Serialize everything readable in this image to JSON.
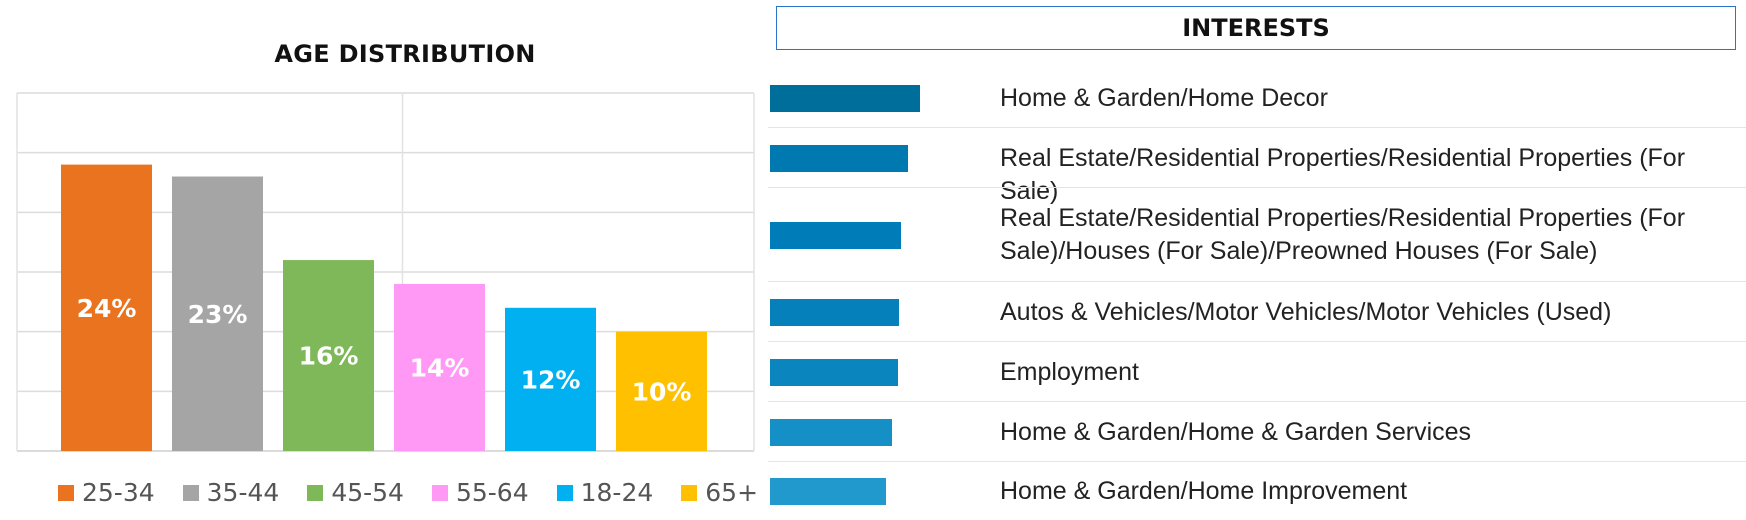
{
  "chart_data": [
    {
      "type": "bar",
      "title": "AGE DISTRIBUTION",
      "categories": [
        "25-34",
        "35-44",
        "45-54",
        "55-64",
        "18-24",
        "65+"
      ],
      "values": [
        24,
        23,
        16,
        14,
        12,
        10
      ],
      "data_labels": [
        "24%",
        "23%",
        "16%",
        "14%",
        "12%",
        "10%"
      ],
      "colors": [
        "#ea7320",
        "#a5a5a5",
        "#7fb858",
        "#ff99f5",
        "#00b0f0",
        "#ffc000"
      ],
      "legend": [
        "25-34",
        "35-44",
        "45-54",
        "55-64",
        "18-24",
        "65+"
      ],
      "legend_position": "bottom",
      "ylim": [
        0,
        30
      ],
      "grid": true,
      "xlabel": "",
      "ylabel": ""
    },
    {
      "type": "bar",
      "orientation": "horizontal",
      "title": "INTERESTS",
      "categories": [
        "Home & Garden/Home Decor",
        "Real Estate/Residential Properties/Residential Properties (For Sale)",
        "Real Estate/Residential Properties/Residential Properties (For Sale)/Houses (For Sale)/Preowned Houses (For Sale)",
        "Autos & Vehicles/Motor Vehicles/Motor Vehicles (Used)",
        "Employment",
        "Home & Garden/Home & Garden Services",
        "Home & Garden/Home Improvement"
      ],
      "values": [
        1.0,
        0.92,
        0.87,
        0.86,
        0.85,
        0.81,
        0.77
      ],
      "colors": [
        "#006e9a",
        "#0079b1",
        "#007db8",
        "#0580bb",
        "#0a85be",
        "#1590c6",
        "#2299cc"
      ],
      "xlabel": "",
      "ylabel": ""
    }
  ]
}
